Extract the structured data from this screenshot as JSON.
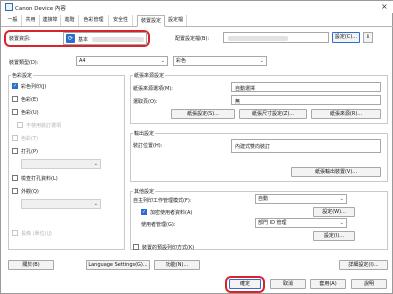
{
  "window": {
    "title": "Canon Device 內容"
  },
  "tabs": [
    "一般",
    "共用",
    "連接埠",
    "進階",
    "色彩管理",
    "安全性",
    "裝置設定",
    "設定檔"
  ],
  "device_name": {
    "label": "裝置資訊:",
    "value": "基本"
  },
  "config": {
    "label": "配置設定檔(B):",
    "value": "",
    "settings_btn": "設定(C)..."
  },
  "paper": {
    "label": "裝置類型(D):",
    "size": "A4",
    "color": "彩色"
  },
  "left_group": {
    "title": "色彩設定",
    "items": [
      {
        "label": "彩色列印(J)",
        "checked": true,
        "disabled": false
      },
      {
        "label": "色彩(E)",
        "checked": false,
        "disabled": false
      },
      {
        "label": "色彩(U)",
        "checked": false,
        "disabled": false
      },
      {
        "label": "不使用裝訂選項",
        "checked": false,
        "disabled": true
      },
      {
        "label": "色彩(T)",
        "checked": false,
        "disabled": true
      },
      {
        "label": "打孔(P)",
        "checked": false,
        "disabled": false
      },
      {
        "label": "",
        "checked": false,
        "disabled": true,
        "is_dropdown": true
      },
      {
        "label": "檢查打孔資料(L)",
        "checked": false,
        "disabled": false
      },
      {
        "label": "外觀(Q)",
        "checked": false,
        "disabled": false
      },
      {
        "label": "",
        "checked": false,
        "disabled": true,
        "is_dropdown": true
      },
      {
        "label": "長條 (單位)(J)",
        "checked": false,
        "disabled": true
      }
    ]
  },
  "copies_group": {
    "title": "紙張來源設定",
    "rows": [
      {
        "label": "紙張來源選項(M):",
        "value": "自動選擇"
      },
      {
        "label": "選取頁(O):",
        "value": "無"
      }
    ],
    "buttons": [
      "紙張設定(S)...",
      "紙張尺寸設定(Z)...",
      "紙張來源(R)..."
    ]
  },
  "output_group": {
    "title": "輸出設定",
    "rows": [
      {
        "label": "裝訂位置(H):",
        "value": "內建式雙向裝訂"
      }
    ],
    "button": "紙張輸出裝置(V)..."
  },
  "other_group": {
    "title": "其他設定",
    "rows": [
      {
        "label": "自主列印工作管理模式(F):",
        "value": "自動"
      },
      {
        "label": "加密使用者資料(A)",
        "value": "",
        "checkbox": true,
        "checked": true
      },
      {
        "label": "使用者管理(G):",
        "value": "部門 ID 管理"
      }
    ],
    "buttons": [
      "設定(W)...",
      "設定(I)..."
    ],
    "bottom_checkbox": "裝置的預設列印方式(K)"
  },
  "footer_buttons": [
    "關於(B)",
    "Language Settings(G)...",
    "功能(N)...",
    "詳細設定(I)..."
  ],
  "dialog_buttons": [
    "確定",
    "取消",
    "套用(A)",
    "說明"
  ],
  "colors": {
    "highlight": "#d9232d",
    "accent": "#2a6fcf"
  }
}
